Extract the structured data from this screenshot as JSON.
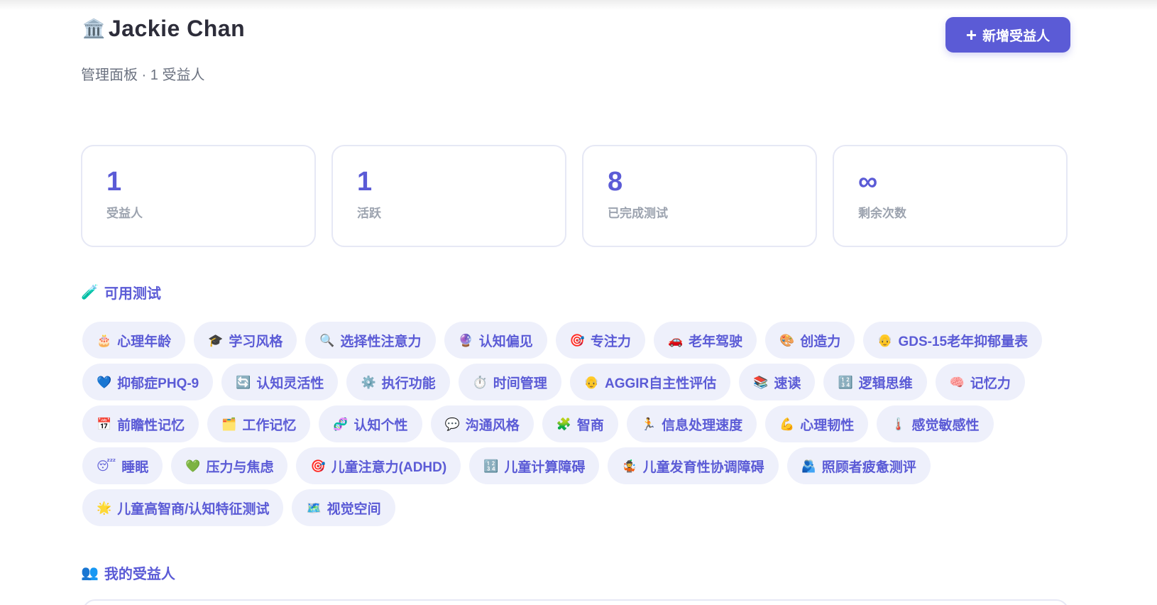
{
  "header": {
    "title_icon": "🏛️",
    "title": "Jackie Chan",
    "subtitle": "管理面板 · 1 受益人",
    "add_button_icon": "+",
    "add_button_label": "新增受益人"
  },
  "stats": [
    {
      "value": "1",
      "label": "受益人"
    },
    {
      "value": "1",
      "label": "活跃"
    },
    {
      "value": "8",
      "label": "已完成测试"
    },
    {
      "value": "∞",
      "label": "剩余次数"
    }
  ],
  "tests_section": {
    "icon": "🧪",
    "title": "可用测试",
    "tests": [
      {
        "icon": "🎂",
        "icon_name": "birthday-cake-icon",
        "label": "心理年龄"
      },
      {
        "icon": "🎓",
        "icon_name": "graduation-cap-icon",
        "label": "学习风格"
      },
      {
        "icon": "🔍",
        "icon_name": "magnifier-icon",
        "label": "选择性注意力"
      },
      {
        "icon": "🔮",
        "icon_name": "crystal-ball-icon",
        "label": "认知偏见"
      },
      {
        "icon": "🎯",
        "icon_name": "target-icon",
        "label": "专注力"
      },
      {
        "icon": "🚗",
        "icon_name": "car-icon",
        "label": "老年驾驶"
      },
      {
        "icon": "🎨",
        "icon_name": "palette-icon",
        "label": "创造力"
      },
      {
        "icon": "👴",
        "icon_name": "elder-icon",
        "label": "GDS-15老年抑郁量表"
      },
      {
        "icon": "💙",
        "icon_name": "blue-heart-icon",
        "label": "抑郁症PHQ-9"
      },
      {
        "icon": "🔄",
        "icon_name": "cycle-arrows-icon",
        "label": "认知灵活性"
      },
      {
        "icon": "⚙️",
        "icon_name": "gear-icon",
        "label": "执行功能"
      },
      {
        "icon": "⏱️",
        "icon_name": "stopwatch-icon",
        "label": "时间管理"
      },
      {
        "icon": "👴",
        "icon_name": "elder-icon",
        "label": "AGGIR自主性评估"
      },
      {
        "icon": "📚",
        "icon_name": "books-icon",
        "label": "速读"
      },
      {
        "icon": "🔢",
        "icon_name": "numbers-icon",
        "label": "逻辑思维"
      },
      {
        "icon": "🧠",
        "icon_name": "brain-icon",
        "label": "记忆力"
      },
      {
        "icon": "📅",
        "icon_name": "calendar-icon",
        "label": "前瞻性记忆"
      },
      {
        "icon": "🗂️",
        "icon_name": "folder-icon",
        "label": "工作记忆"
      },
      {
        "icon": "🧬",
        "icon_name": "dna-icon",
        "label": "认知个性"
      },
      {
        "icon": "💬",
        "icon_name": "speech-bubble-icon",
        "label": "沟通风格"
      },
      {
        "icon": "🧩",
        "icon_name": "puzzle-icon",
        "label": "智商"
      },
      {
        "icon": "🏃",
        "icon_name": "runner-icon",
        "label": "信息处理速度"
      },
      {
        "icon": "💪",
        "icon_name": "flexed-arm-icon",
        "label": "心理韧性"
      },
      {
        "icon": "🌡️",
        "icon_name": "thermometer-icon",
        "label": "感觉敏感性"
      },
      {
        "icon": "😴",
        "icon_name": "sleeping-face-icon",
        "label": "睡眠"
      },
      {
        "icon": "💚",
        "icon_name": "green-heart-icon",
        "label": "压力与焦虑"
      },
      {
        "icon": "🎯",
        "icon_name": "target-icon",
        "label": "儿童注意力(ADHD)"
      },
      {
        "icon": "🔢",
        "icon_name": "numbers-icon",
        "label": "儿童计算障碍"
      },
      {
        "icon": "🤹",
        "icon_name": "juggler-icon",
        "label": "儿童发育性协调障碍"
      },
      {
        "icon": "🫂",
        "icon_name": "people-hugging-icon",
        "label": "照顾者疲惫测评"
      },
      {
        "icon": "🌟",
        "icon_name": "star-icon",
        "label": "儿童高智商/认知特征测试"
      },
      {
        "icon": "🗺️",
        "icon_name": "map-icon",
        "label": "视觉空间"
      }
    ]
  },
  "beneficiaries_section": {
    "icon": "👥",
    "title": "我的受益人"
  },
  "colors": {
    "accent": "#5b5bd6",
    "chip_bg": "#eef0fb",
    "card_border": "#e6e8f5",
    "muted_text": "#9ca3af"
  }
}
